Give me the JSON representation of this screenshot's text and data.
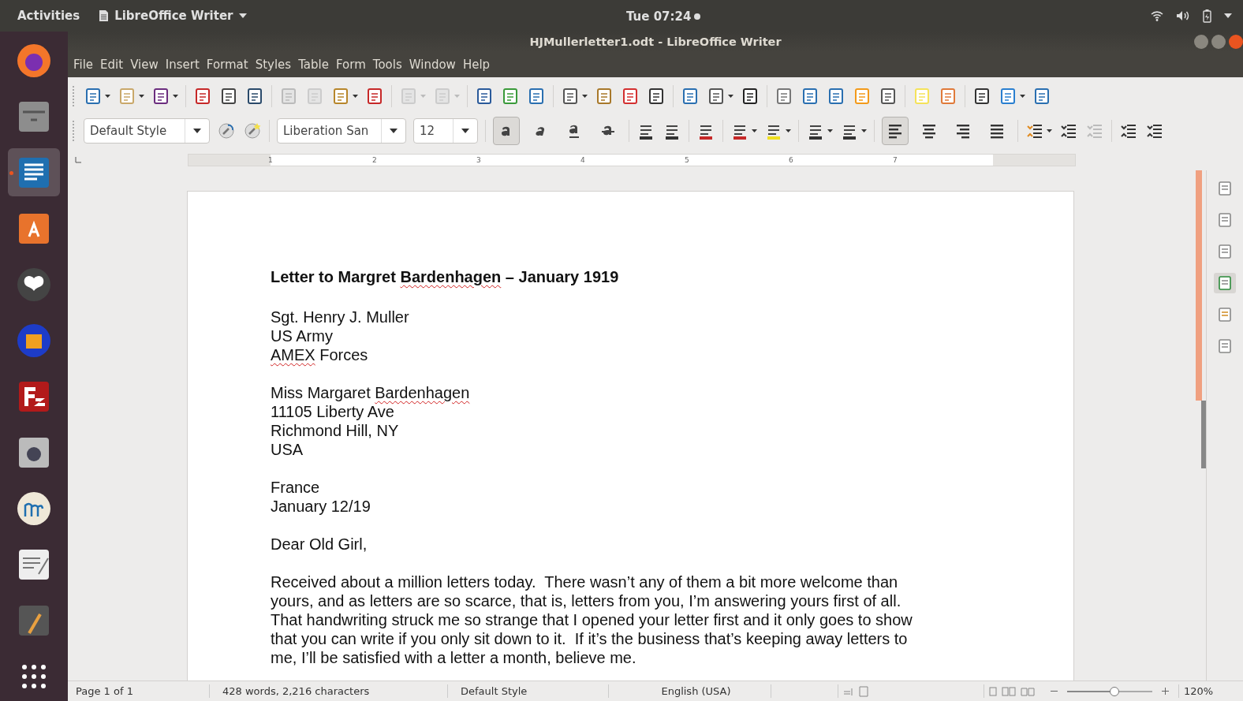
{
  "top_bar": {
    "activities": "Activities",
    "app_menu": "LibreOffice Writer",
    "clock": "Tue 07:24"
  },
  "window": {
    "title": "HJMullerletter1.odt - LibreOffice Writer"
  },
  "dock": [
    {
      "selected": false
    },
    {
      "selected": false
    },
    {
      "selected": true
    },
    {
      "selected": false
    },
    {
      "selected": false
    },
    {
      "selected": false
    },
    {
      "selected": false
    },
    {
      "selected": false
    },
    {
      "selected": false
    },
    {
      "selected": false
    },
    {
      "selected": false
    },
    {
      "selected": false
    }
  ],
  "menu": [
    "File",
    "Edit",
    "View",
    "Insert",
    "Format",
    "Styles",
    "Table",
    "Form",
    "Tools",
    "Window",
    "Help"
  ],
  "toolbar": {
    "paragraph_style": "Default Style",
    "font_name": "Liberation San",
    "font_size": "12",
    "format_buttons": [
      {
        "kind": "bold",
        "selected": true
      },
      {
        "kind": "italic",
        "selected": false
      },
      {
        "kind": "underline",
        "selected": false
      },
      {
        "kind": "strikethrough",
        "selected": false
      }
    ],
    "align_buttons": [
      {
        "kind": "left",
        "selected": true
      },
      {
        "kind": "center",
        "selected": false
      },
      {
        "kind": "right",
        "selected": false
      },
      {
        "kind": "justify",
        "selected": false
      }
    ]
  },
  "ruler": {
    "labels": [
      "1",
      "2",
      "3",
      "4",
      "5",
      "6",
      "7"
    ]
  },
  "document": {
    "title": [
      {
        "text": "Letter to Margret ",
        "misspelled": false
      },
      {
        "text": "Bardenhagen",
        "misspelled": true
      },
      {
        "text": " – January 1919",
        "misspelled": false
      }
    ],
    "blocks": [
      [
        [
          {
            "text": "Sgt. Henry J. Muller",
            "misspelled": false
          }
        ],
        [
          {
            "text": "US Army",
            "misspelled": false
          }
        ],
        [
          {
            "text": "AMEX",
            "misspelled": true
          },
          {
            "text": " Forces",
            "misspelled": false
          }
        ]
      ],
      [
        [
          {
            "text": "Miss Margaret ",
            "misspelled": false
          },
          {
            "text": "Bardenhagen",
            "misspelled": true
          }
        ],
        [
          {
            "text": "11105 Liberty Ave",
            "misspelled": false
          }
        ],
        [
          {
            "text": "Richmond Hill, NY",
            "misspelled": false
          }
        ],
        [
          {
            "text": "USA",
            "misspelled": false
          }
        ]
      ],
      [
        [
          {
            "text": "France",
            "misspelled": false
          }
        ],
        [
          {
            "text": "January 12/19",
            "misspelled": false
          }
        ]
      ],
      [
        [
          {
            "text": "Dear Old Girl,",
            "misspelled": false
          }
        ]
      ],
      [
        [
          {
            "text": "Received about a million letters today.  There wasn’t any of them a bit more welcome than",
            "misspelled": false
          }
        ],
        [
          {
            "text": "yours, and as letters are so scarce, that is, letters from you, I’m answering yours first of all.",
            "misspelled": false
          }
        ],
        [
          {
            "text": "That handwriting struck me so strange that I opened your letter first and it only goes to show",
            "misspelled": false
          }
        ],
        [
          {
            "text": "that you can write if you only sit down to it.  If it’s the business that’s keeping away letters to",
            "misspelled": false
          }
        ],
        [
          {
            "text": "me, I’ll be satisfied with a letter a month, believe me.",
            "misspelled": false
          }
        ]
      ]
    ]
  },
  "sidebar": [
    {
      "selected": false
    },
    {
      "selected": false
    },
    {
      "selected": false
    },
    {
      "selected": true
    },
    {
      "selected": false
    },
    {
      "selected": false
    }
  ],
  "status_bar": {
    "page": "Page 1 of 1",
    "words": "428 words, 2,216 characters",
    "style": "Default Style",
    "language": "English (USA)",
    "zoom": "120%",
    "zoom_slider": {
      "level": 0.5
    }
  }
}
